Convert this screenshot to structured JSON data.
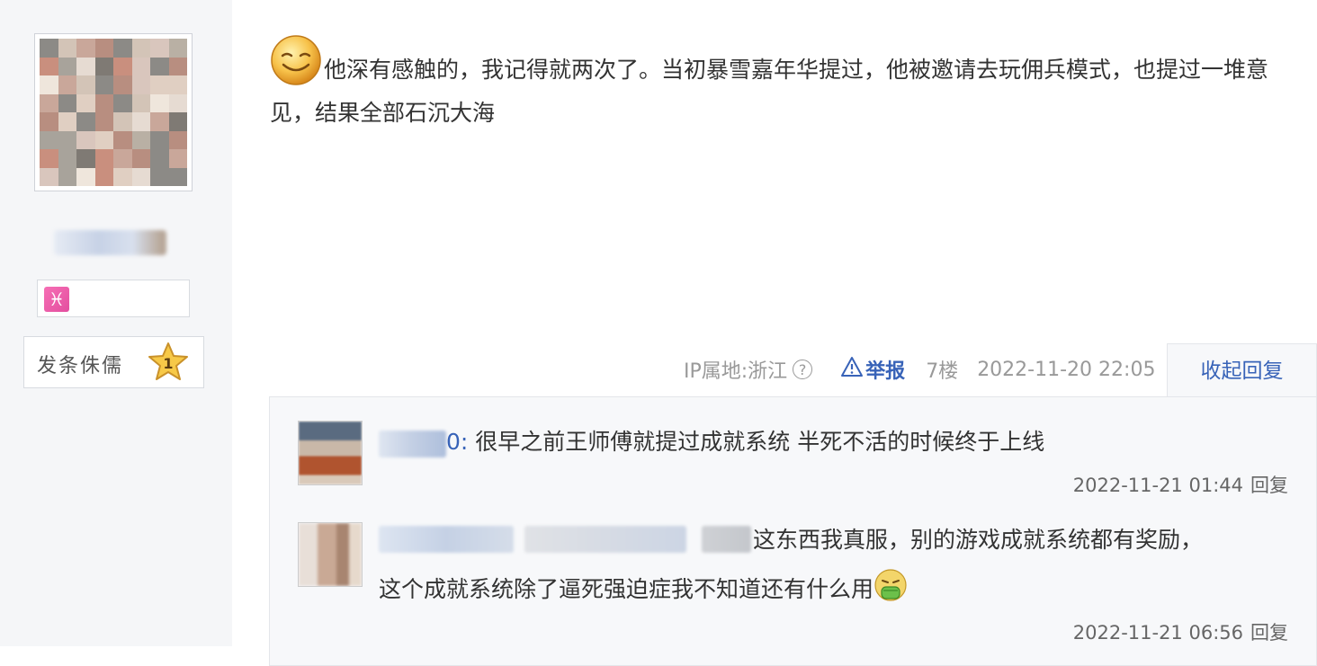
{
  "user": {
    "level_title": "发条侏儒",
    "level_number": "1",
    "zodiac_symbol": "♓"
  },
  "post": {
    "text": "他深有感触的，我记得就两次了。当初暴雪嘉年华提过，他被邀请去玩佣兵模式，也提过一堆意见，结果全部石沉大海",
    "ip_location": "IP属地:浙江",
    "help_symbol": "?",
    "report_label": "举报",
    "floor": "7楼",
    "timestamp": "2022-11-20 22:05",
    "collapse_label": "收起回复"
  },
  "replies": [
    {
      "name_suffix": "0: ",
      "text": "很早之前王师傅就提过成就系统 半死不活的时候终于上线",
      "timestamp": "2022-11-21 01:44",
      "reply_label": "回复"
    },
    {
      "text_line1": "这东西我真服，别的游戏成就系统都有奖励，",
      "text_line2": "这个成就系统除了逼死强迫症我不知道还有什么用",
      "timestamp": "2022-11-21 06:56",
      "reply_label": "回复"
    }
  ],
  "colors": {
    "link": "#3863b8",
    "meta": "#999999",
    "sidebar_bg": "#f5f6f8",
    "reply_bg": "#f7f8fa"
  }
}
